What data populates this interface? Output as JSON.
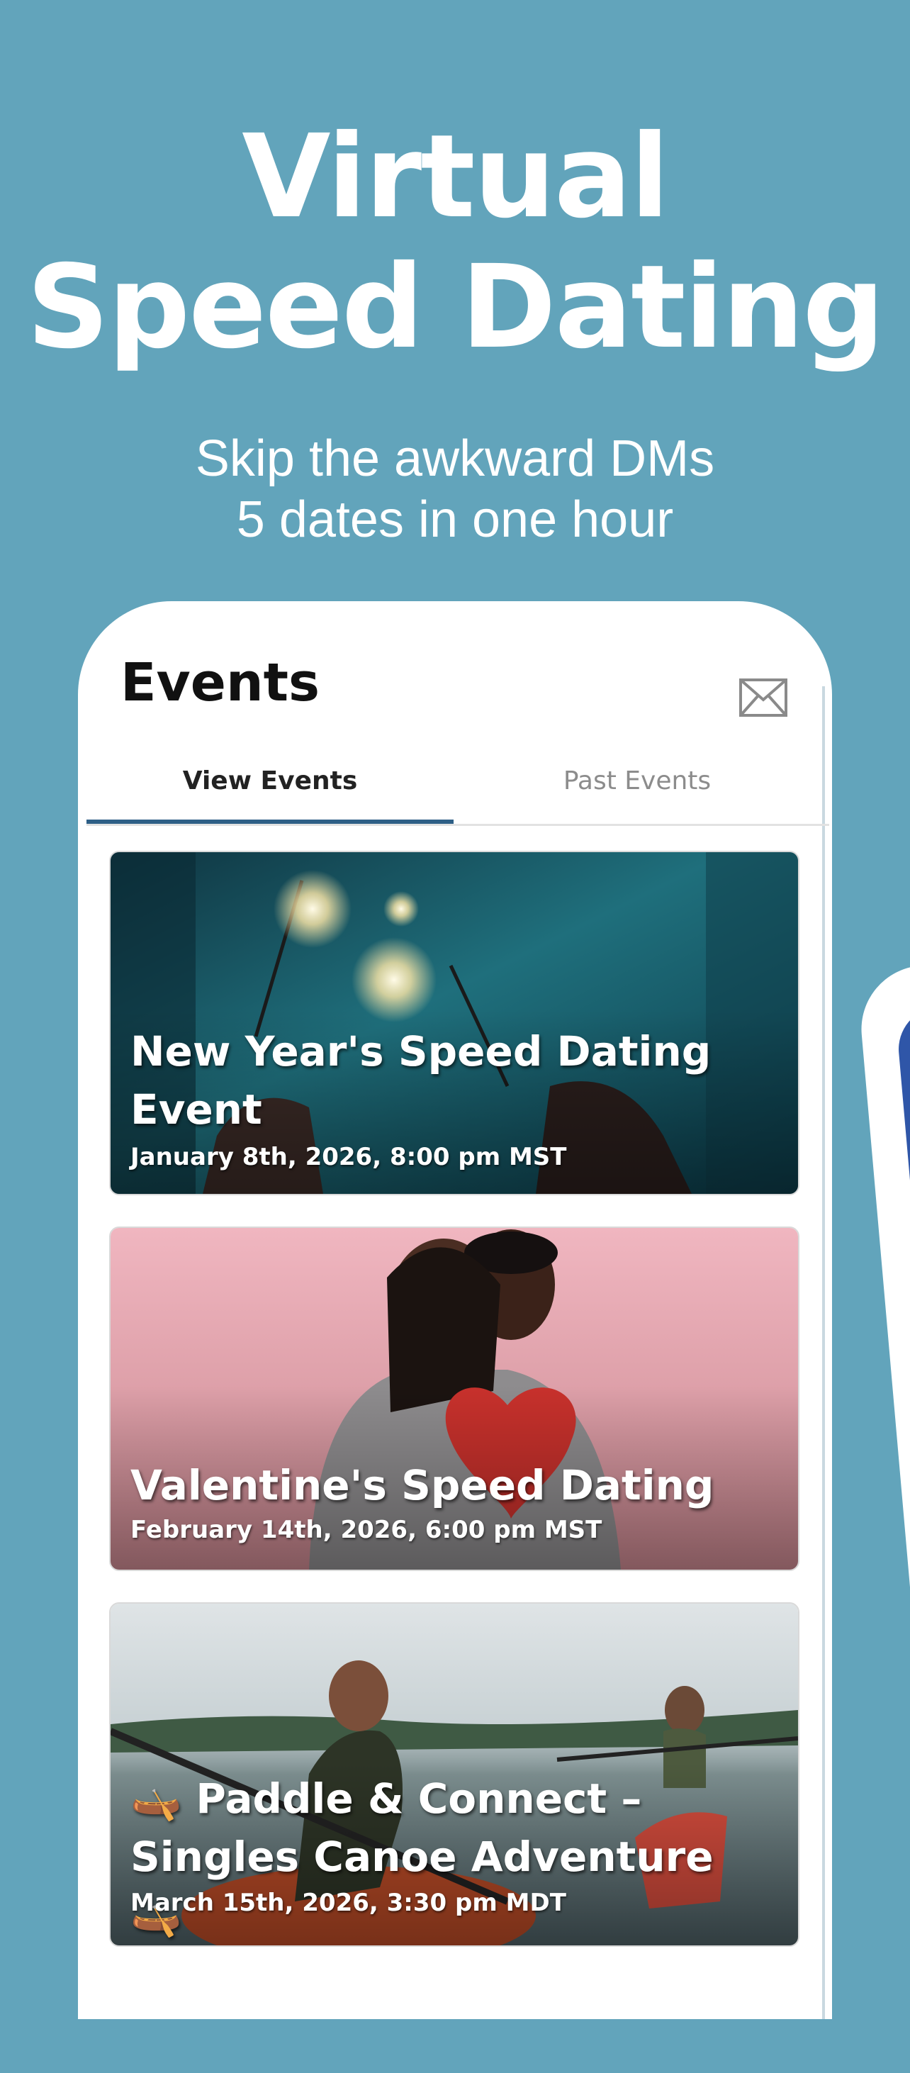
{
  "hero": {
    "title_line1": "Virtual",
    "title_line2": "Speed Dating",
    "subtitle_line1": "Skip the awkward DMs",
    "subtitle_line2": "5 dates in one hour"
  },
  "app": {
    "header_title": "Events",
    "header_icon": "mail-icon",
    "tabs": [
      {
        "label": "View Events",
        "active": true
      },
      {
        "label": "Past Events",
        "active": false
      }
    ],
    "events": [
      {
        "title": "New Year's Speed Dating Event",
        "date": "January 8th, 2026, 8:00 pm MST",
        "image": "sparklers-photo"
      },
      {
        "title": "Valentine's Speed Dating",
        "date": "February 14th, 2026, 6:00 pm MST",
        "image": "couple-heart-photo"
      },
      {
        "title": "🛶 Paddle & Connect – Singles Canoe Adventure 🛶",
        "date": "March 15th, 2026, 3:30 pm MDT",
        "image": "kayaking-couple-photo"
      }
    ]
  },
  "colors": {
    "background": "#62a4bb",
    "tab_underline": "#2e5f86",
    "card_text": "#ffffff"
  }
}
